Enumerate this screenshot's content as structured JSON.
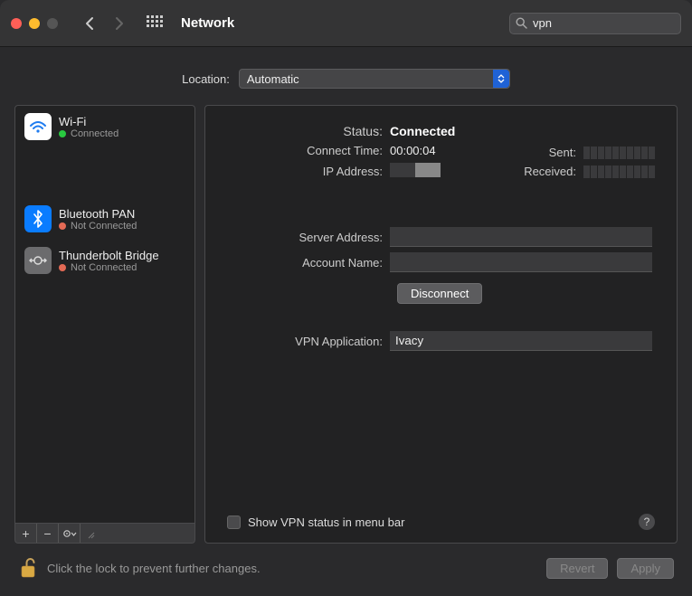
{
  "titlebar": {
    "title": "Network",
    "search_value": "vpn"
  },
  "location": {
    "label": "Location:",
    "value": "Automatic"
  },
  "sidebar": {
    "items": [
      {
        "name": "Wi-Fi",
        "status_text": "Connected",
        "status_color": "green",
        "icon": "wifi"
      },
      {
        "name": "Bluetooth PAN",
        "status_text": "Not Connected",
        "status_color": "red",
        "icon": "bluetooth"
      },
      {
        "name": "Thunderbolt Bridge",
        "status_text": "Not Connected",
        "status_color": "red",
        "icon": "thunderbolt"
      }
    ]
  },
  "detail": {
    "status_label": "Status:",
    "status_value": "Connected",
    "connect_time_label": "Connect Time:",
    "connect_time_value": "00:00:04",
    "ip_label": "IP Address:",
    "sent_label": "Sent:",
    "received_label": "Received:",
    "server_address_label": "Server Address:",
    "server_address_value": "",
    "account_name_label": "Account Name:",
    "account_name_value": "",
    "disconnect_label": "Disconnect",
    "vpn_app_label": "VPN Application:",
    "vpn_app_value": "Ivacy",
    "show_status_label": "Show VPN status in menu bar"
  },
  "footer": {
    "lock_text": "Click the lock to prevent further changes.",
    "revert_label": "Revert",
    "apply_label": "Apply"
  }
}
